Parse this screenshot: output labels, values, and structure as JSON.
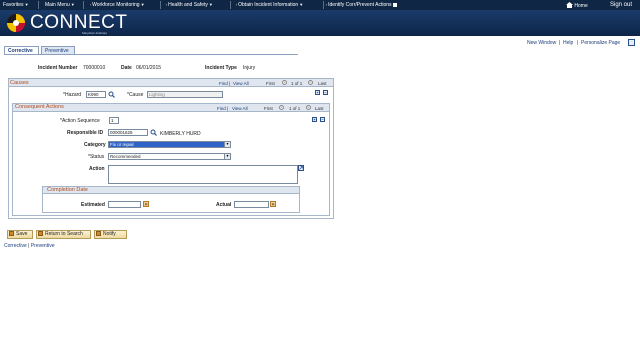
{
  "nav": {
    "favorites": "Favorites",
    "main_menu": "Main Menu",
    "workforce": "Workforce Monitoring",
    "health": "Health and Safety",
    "obtain": "Obtain Incident Information",
    "identify": "Identify Corr/Prevent Actions",
    "home": "Home",
    "signout": "Sign out"
  },
  "header": {
    "logo": "CONNECT",
    "subtitle": "Maryland Judiciary"
  },
  "toolbar": {
    "new_window": "New Window",
    "help": "Help",
    "personalize": "Personalize Page",
    "sep": "|"
  },
  "tabs": [
    {
      "label": "Corrective"
    },
    {
      "label": "Preventive"
    }
  ],
  "incident": {
    "number_label": "Incident Number",
    "number": "70000010",
    "date_label": "Date",
    "date": "06/01/2015",
    "type_label": "Incident Type",
    "type": "Injury"
  },
  "causes": {
    "title": "Causes",
    "find": "Find",
    "view_all": "View All",
    "first": "First",
    "pos": "1 of 1",
    "last": "Last",
    "hazard_label": "*Hazard",
    "hazard": "K990",
    "cause_label": "*Cause",
    "cause": "Lighting"
  },
  "consequent": {
    "title": "Consequent Actions",
    "find": "Find",
    "view_all": "View All",
    "first": "First",
    "pos": "1 of 1",
    "last": "Last",
    "seq_label": "*Action Sequence",
    "seq": "1",
    "resp_label": "Responsible ID",
    "resp": "000001625",
    "resp_name": "KIMBERLY HURD",
    "category_label": "Category",
    "category": "Fix or repair",
    "status_label": "*Status",
    "status": "Recommended",
    "action_label": "Action"
  },
  "completion": {
    "title": "Completion Date",
    "estimated_label": "Estimated",
    "estimated": "",
    "actual_label": "Actual",
    "actual": ""
  },
  "buttons": {
    "save": "Save",
    "return": "Return to Search",
    "notify": "Notify"
  },
  "bottom": {
    "corrective": "Corrective",
    "sep": " | ",
    "preventive": "Preventive"
  },
  "colors": {
    "nav_bg": "#0f2745",
    "banner": "#1a3b6b",
    "link": "#1a3c7a",
    "section_title": "#b04a1c"
  }
}
